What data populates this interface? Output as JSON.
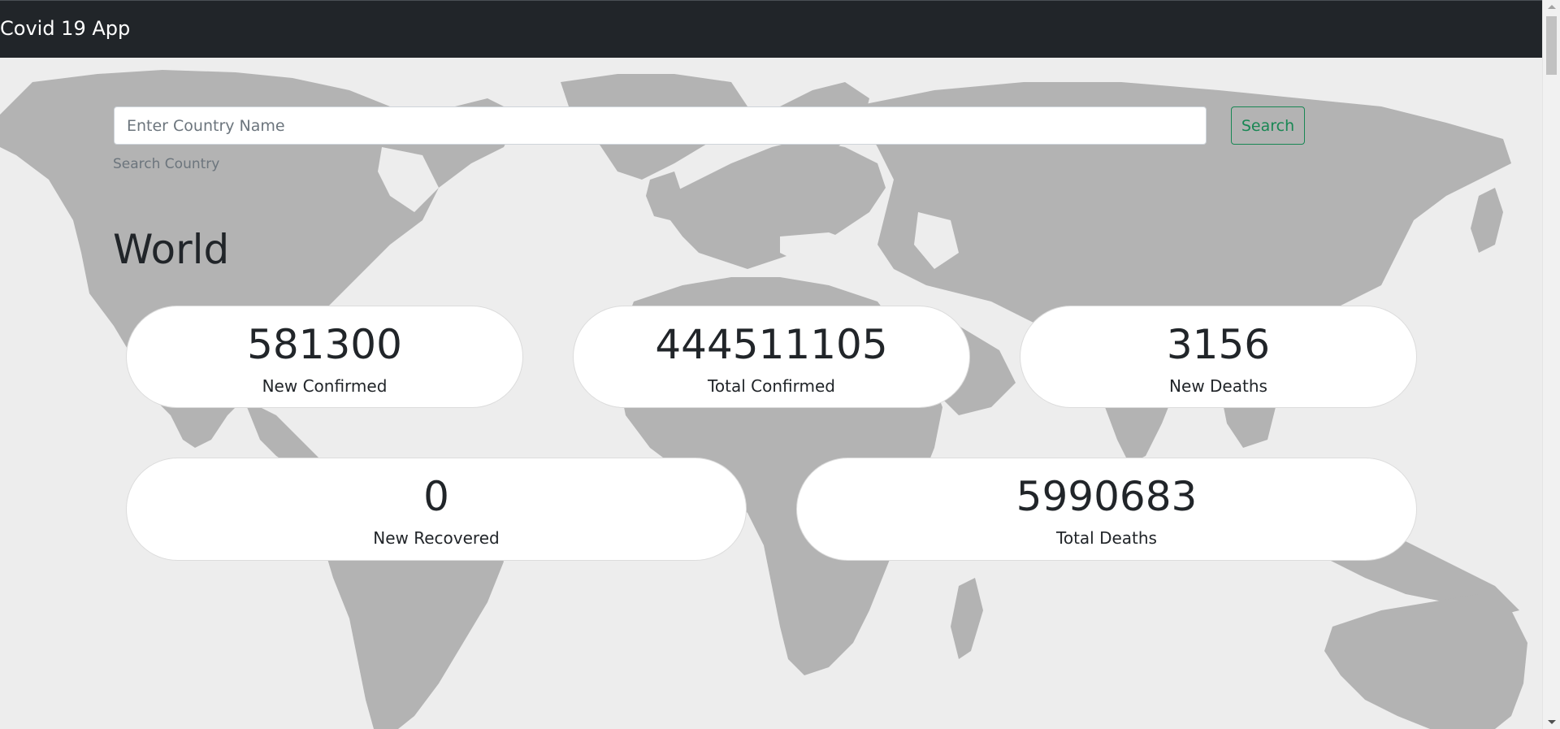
{
  "navbar": {
    "brand": "Covid 19 App"
  },
  "search": {
    "placeholder": "Enter Country Name",
    "value": "",
    "button_label": "Search",
    "help_text": "Search Country"
  },
  "section": {
    "title": "World"
  },
  "stats": [
    {
      "value": "581300",
      "label": "New Confirmed"
    },
    {
      "value": "444511105",
      "label": "Total Confirmed"
    },
    {
      "value": "3156",
      "label": "New Deaths"
    },
    {
      "value": "0",
      "label": "New Recovered"
    },
    {
      "value": "5990683",
      "label": "Total Deaths"
    }
  ],
  "colors": {
    "navbar": "#212529",
    "accent": "#198754",
    "map_land": "#b3b3b3",
    "background": "#ededed"
  }
}
